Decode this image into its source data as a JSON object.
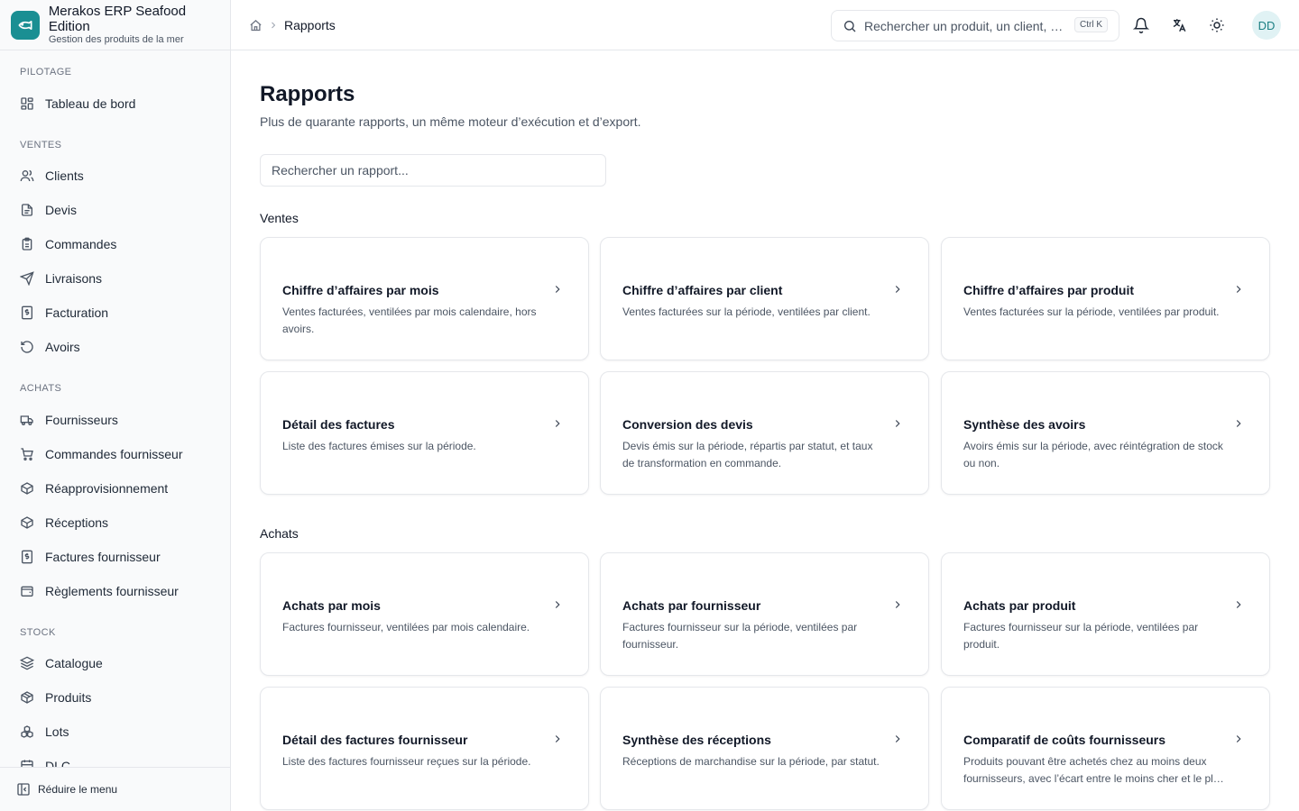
{
  "brand": {
    "title": "Merakos ERP Seafood Edition",
    "subtitle": "Gestion des produits de la mer"
  },
  "sidebar": {
    "sections": [
      {
        "label": "PILOTAGE",
        "items": [
          {
            "label": "Tableau de bord",
            "icon": "dashboard-icon"
          }
        ]
      },
      {
        "label": "VENTES",
        "items": [
          {
            "label": "Clients",
            "icon": "users-icon"
          },
          {
            "label": "Devis",
            "icon": "file-icon"
          },
          {
            "label": "Commandes",
            "icon": "clipboard-icon"
          },
          {
            "label": "Livraisons",
            "icon": "send-icon"
          },
          {
            "label": "Facturation",
            "icon": "invoice-icon"
          },
          {
            "label": "Avoirs",
            "icon": "undo-icon"
          }
        ]
      },
      {
        "label": "ACHATS",
        "items": [
          {
            "label": "Fournisseurs",
            "icon": "truck-icon"
          },
          {
            "label": "Commandes fournisseur",
            "icon": "cart-icon"
          },
          {
            "label": "Réapprovisionnement",
            "icon": "package-refresh-icon"
          },
          {
            "label": "Réceptions",
            "icon": "package-check-icon"
          },
          {
            "label": "Factures fournisseur",
            "icon": "invoice-icon"
          },
          {
            "label": "Règlements fournisseur",
            "icon": "wallet-icon"
          }
        ]
      },
      {
        "label": "STOCK",
        "items": [
          {
            "label": "Catalogue",
            "icon": "layers-icon"
          },
          {
            "label": "Produits",
            "icon": "box-icon"
          },
          {
            "label": "Lots",
            "icon": "boxes-icon"
          },
          {
            "label": "DLC",
            "icon": "calendar-icon"
          }
        ]
      }
    ],
    "collapse_label": "Réduire le menu"
  },
  "topbar": {
    "breadcrumb_current": "Rapports",
    "search_placeholder": "Rechercher un produit, un client, une commande",
    "search_shortcut": "Ctrl K",
    "avatar_initials": "DD"
  },
  "page": {
    "title": "Rapports",
    "subtitle": "Plus de quarante rapports, un même moteur d’exécution et d’export.",
    "search_placeholder": "Rechercher un rapport..."
  },
  "sections": [
    {
      "title": "Ventes",
      "reports": [
        {
          "title": "Chiffre d’affaires par mois",
          "description": "Ventes facturées, ventilées par mois calendaire, hors avoirs."
        },
        {
          "title": "Chiffre d’affaires par client",
          "description": "Ventes facturées sur la période, ventilées par client."
        },
        {
          "title": "Chiffre d’affaires par produit",
          "description": "Ventes facturées sur la période, ventilées par produit."
        },
        {
          "title": "Détail des factures",
          "description": "Liste des factures émises sur la période."
        },
        {
          "title": "Conversion des devis",
          "description": "Devis émis sur la période, répartis par statut, et taux de transformation en commande."
        },
        {
          "title": "Synthèse des avoirs",
          "description": "Avoirs émis sur la période, avec réintégration de stock ou non."
        }
      ]
    },
    {
      "title": "Achats",
      "reports": [
        {
          "title": "Achats par mois",
          "description": "Factures fournisseur, ventilées par mois calendaire."
        },
        {
          "title": "Achats par fournisseur",
          "description": "Factures fournisseur sur la période, ventilées par fournisseur."
        },
        {
          "title": "Achats par produit",
          "description": "Factures fournisseur sur la période, ventilées par produit."
        },
        {
          "title": "Détail des factures fournisseur",
          "description": "Liste des factures fournisseur reçues sur la période."
        },
        {
          "title": "Synthèse des réceptions",
          "description": "Réceptions de marchandise sur la période, par statut."
        },
        {
          "title": "Comparatif de coûts fournisseurs",
          "description": "Produits pouvant être achetés chez au moins deux fournisseurs, avec l’écart entre le moins cher et le plus cher."
        }
      ]
    }
  ],
  "colors": {
    "accent": "#1a8f93",
    "border": "#e5e7eb",
    "muted_text": "#4b5563"
  }
}
